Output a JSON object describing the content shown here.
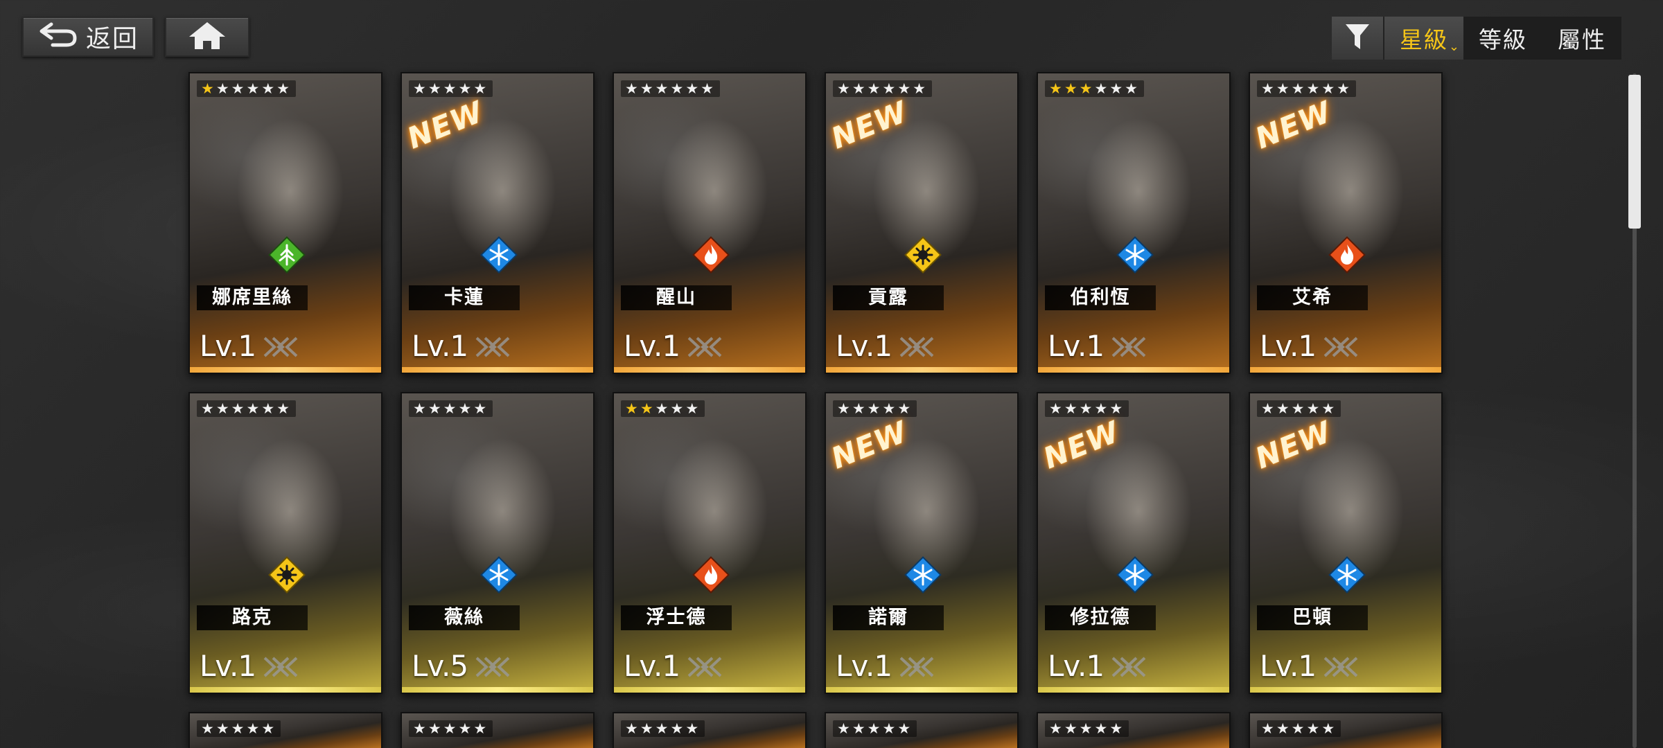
{
  "header": {
    "back_label": "返回",
    "back_icon": "return-arrow-icon",
    "home_icon": "home-icon",
    "filter_icon": "funnel-icon",
    "sort_tabs": [
      {
        "label": "星級",
        "active": true
      },
      {
        "label": "等級",
        "active": false
      },
      {
        "label": "屬性",
        "active": false
      }
    ]
  },
  "colors": {
    "accent": "#f5c518",
    "element_nature": "#4bb52a",
    "element_ice": "#1e88e5",
    "element_fire": "#e8501a",
    "element_light": "#f5c518"
  },
  "scroll": {
    "position": 0.0
  },
  "characters": [
    {
      "name": "娜席里絲",
      "level": "Lv.1",
      "stars": 6,
      "lit_stars": 1,
      "element": "nature-element-icon",
      "is_new": false
    },
    {
      "name": "卡蓮",
      "level": "Lv.1",
      "stars": 5,
      "lit_stars": 0,
      "element": "ice-element-icon",
      "is_new": true,
      "new_label": "NEW"
    },
    {
      "name": "醒山",
      "level": "Lv.1",
      "stars": 6,
      "lit_stars": 0,
      "element": "fire-element-icon",
      "is_new": false
    },
    {
      "name": "貢露",
      "level": "Lv.1",
      "stars": 6,
      "lit_stars": 0,
      "element": "light-element-icon",
      "is_new": true,
      "new_label": "NEW"
    },
    {
      "name": "伯利恆",
      "level": "Lv.1",
      "stars": 6,
      "lit_stars": 3,
      "element": "ice-element-icon",
      "is_new": false
    },
    {
      "name": "艾希",
      "level": "Lv.1",
      "stars": 6,
      "lit_stars": 0,
      "element": "fire-element-icon",
      "is_new": true,
      "new_label": "NEW"
    },
    {
      "name": "路克",
      "level": "Lv.1",
      "stars": 6,
      "lit_stars": 0,
      "element": "light-element-icon",
      "is_new": false
    },
    {
      "name": "薇絲",
      "level": "Lv.5",
      "stars": 5,
      "lit_stars": 0,
      "element": "ice-element-icon",
      "is_new": false
    },
    {
      "name": "浮士德",
      "level": "Lv.1",
      "stars": 5,
      "lit_stars": 2,
      "element": "fire-element-icon",
      "is_new": false
    },
    {
      "name": "諾爾",
      "level": "Lv.1",
      "stars": 5,
      "lit_stars": 0,
      "element": "ice-element-icon",
      "is_new": true,
      "new_label": "NEW"
    },
    {
      "name": "修拉德",
      "level": "Lv.1",
      "stars": 5,
      "lit_stars": 0,
      "element": "ice-element-icon",
      "is_new": true,
      "new_label": "NEW"
    },
    {
      "name": "巴頓",
      "level": "Lv.1",
      "stars": 5,
      "lit_stars": 0,
      "element": "ice-element-icon",
      "is_new": true,
      "new_label": "NEW"
    }
  ],
  "partial_row_stars": [
    5,
    5,
    5,
    5,
    5,
    5
  ]
}
